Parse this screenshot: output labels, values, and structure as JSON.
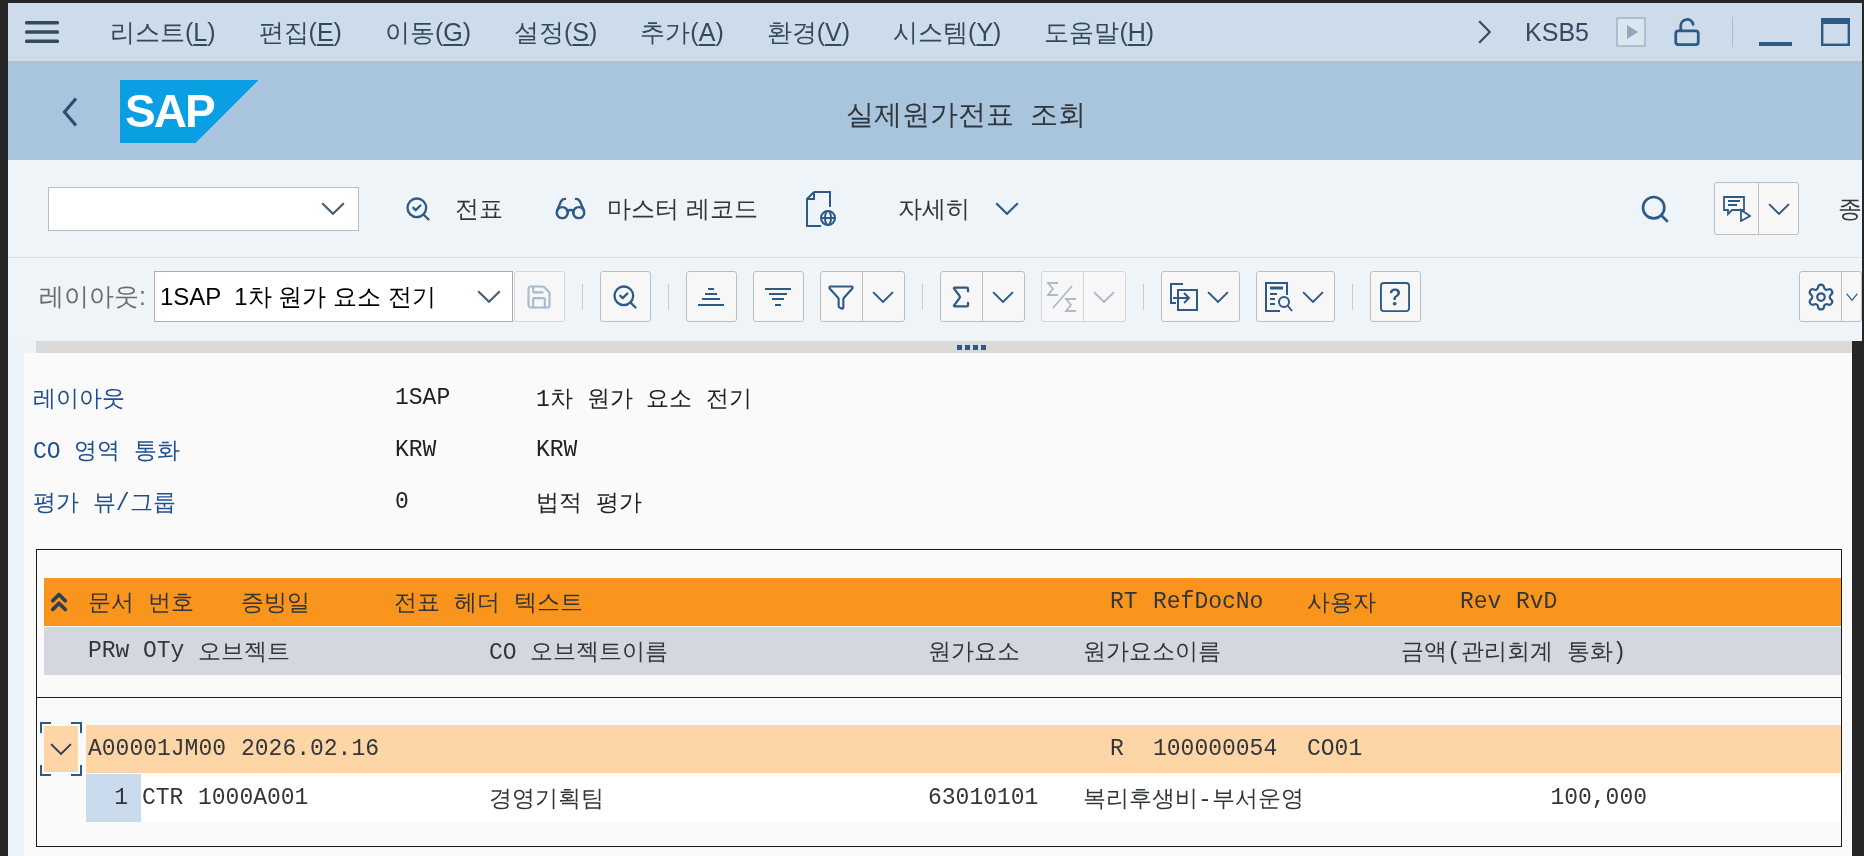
{
  "menu_bar": {
    "items": [
      {
        "prefix": "리스트(",
        "mnemonic": "L",
        "suffix": ")"
      },
      {
        "prefix": "편집(",
        "mnemonic": "E",
        "suffix": ")"
      },
      {
        "prefix": "이동(",
        "mnemonic": "G",
        "suffix": ")"
      },
      {
        "prefix": "설정(",
        "mnemonic": "S",
        "suffix": ")"
      },
      {
        "prefix": "추가(",
        "mnemonic": "A",
        "suffix": ")"
      },
      {
        "prefix": "환경(",
        "mnemonic": "V",
        "suffix": ")"
      },
      {
        "prefix": "시스템(",
        "mnemonic": "Y",
        "suffix": ")"
      },
      {
        "prefix": "도움말(",
        "mnemonic": "H",
        "suffix": ")"
      }
    ],
    "transaction_code": "KSB5"
  },
  "title_bar": {
    "logo": "SAP",
    "title": "실제원가전표  조회"
  },
  "toolbar": {
    "document_button": "전표",
    "master_record_button": "마스터 레코드",
    "details_menu": "자세히",
    "exit_button": "종"
  },
  "alv_toolbar": {
    "layout_label": "레이아웃:",
    "layout_value": "1SAP  1차 원가 요소 전기",
    "save_button": {
      "disabled": true
    },
    "groups": [
      [
        {
          "kind": "inspect",
          "dropdown": false,
          "disabled": false
        }
      ],
      [
        {
          "kind": "ascending",
          "dropdown": false,
          "disabled": false
        },
        {
          "kind": "descending",
          "dropdown": false,
          "disabled": false
        },
        {
          "kind": "filter",
          "dropdown": true,
          "disabled": false
        }
      ],
      [
        {
          "kind": "total",
          "dropdown": true,
          "disabled": false
        },
        {
          "kind": "subtotal",
          "dropdown": true,
          "disabled": true
        }
      ],
      [
        {
          "kind": "export",
          "dropdown": true,
          "disabled": false
        },
        {
          "kind": "view",
          "dropdown": true,
          "disabled": false
        }
      ],
      [
        {
          "kind": "help",
          "dropdown": false,
          "disabled": false
        }
      ]
    ],
    "right_group": [
      {
        "kind": "settings",
        "dropdown": true,
        "disabled": false
      }
    ]
  },
  "header_fields": [
    {
      "label": "레이아웃",
      "code": "1SAP",
      "text": "1차 원가 요소 전기"
    },
    {
      "label": "CO 영역 통화",
      "code": "KRW",
      "text": "KRW"
    },
    {
      "label": "평가 뷰/그룹",
      "code": "0",
      "text": "법적 평가"
    }
  ],
  "list": {
    "header_row": [
      "문서 번호",
      "증빙일",
      "전표 헤더 텍스트",
      "RT",
      "RefDocNo",
      "사용자",
      "Rev",
      "RvD"
    ],
    "subheader_row": [
      "PRw",
      "OTy",
      "오브젝트",
      "CO 오브젝트이름",
      "원가요소",
      "원가요소이름",
      "금액(관리회계 통화)"
    ],
    "documents": [
      {
        "expanded": true,
        "focused": true,
        "cells": [
          "A00001JM00",
          "2026.02.16",
          "R",
          "100000054",
          "CO01"
        ],
        "lines": [
          {
            "cells": [
              "1",
              "CTR",
              "1000A001",
              "경영기획팀",
              "63010101",
              "복리후생비-부서운영",
              "100,000"
            ]
          }
        ]
      }
    ]
  }
}
